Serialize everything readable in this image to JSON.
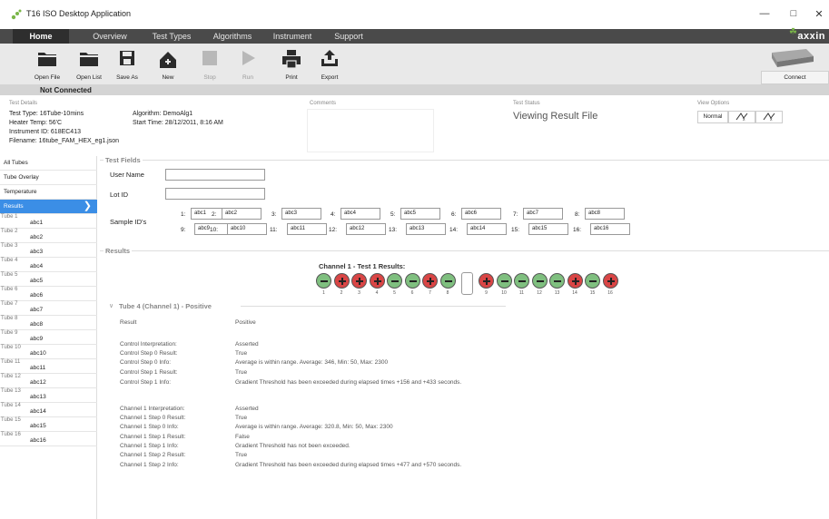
{
  "window": {
    "title": "T16 ISO Desktop Application",
    "minimize": "—",
    "maximize": "□",
    "close": "✕"
  },
  "menu": {
    "items": [
      "Home",
      "Overview",
      "Test Types",
      "Algorithms",
      "Instrument",
      "Support"
    ],
    "active": "Home",
    "brand": "axxin"
  },
  "toolbar": {
    "open_file": "Open File",
    "open_list": "Open List",
    "save_as": "Save As",
    "new": "New",
    "stop": "Stop",
    "run": "Run",
    "print": "Print",
    "export": "Export",
    "connect": "Connect"
  },
  "status": {
    "connection": "Not Connected"
  },
  "details": {
    "header": "Test Details",
    "test_type": "Test Type: 16Tube-10mins",
    "heater_temp": "Heater Temp: 56'C",
    "instrument_id": "Instrument ID: 618EC413",
    "filename": "Filename: 16tube_FAM_HEX_eg1.json",
    "algorithm": "Algorithm: DemoAlg1",
    "start_time": "Start Time: 28/12/2011, 8:16 AM",
    "comments_header": "Comments",
    "status_header": "Test Status",
    "status_value": "Viewing Result File",
    "view_header": "View Options",
    "view_normal": "Normal"
  },
  "sidebar": {
    "items": [
      "All Tubes",
      "Tube Overlay",
      "Temperature",
      "Results"
    ],
    "active": "Results",
    "tubes": [
      {
        "num": "Tube 1",
        "name": "abc1"
      },
      {
        "num": "Tube 2",
        "name": "abc2"
      },
      {
        "num": "Tube 3",
        "name": "abc3"
      },
      {
        "num": "Tube 4",
        "name": "abc4"
      },
      {
        "num": "Tube 5",
        "name": "abc5"
      },
      {
        "num": "Tube 6",
        "name": "abc6"
      },
      {
        "num": "Tube 7",
        "name": "abc7"
      },
      {
        "num": "Tube 8",
        "name": "abc8"
      },
      {
        "num": "Tube 9",
        "name": "abc9"
      },
      {
        "num": "Tube 10",
        "name": "abc10"
      },
      {
        "num": "Tube 11",
        "name": "abc11"
      },
      {
        "num": "Tube 12",
        "name": "abc12"
      },
      {
        "num": "Tube 13",
        "name": "abc13"
      },
      {
        "num": "Tube 14",
        "name": "abc14"
      },
      {
        "num": "Tube 15",
        "name": "abc15"
      },
      {
        "num": "Tube 16",
        "name": "abc16"
      }
    ]
  },
  "test_fields": {
    "legend": "Test Fields",
    "user_name_label": "User Name",
    "user_name": "",
    "lot_id_label": "Lot ID",
    "lot_id": "",
    "sample_ids_label": "Sample ID's",
    "samples": [
      {
        "n": "1:",
        "v": "abc1"
      },
      {
        "n": "2:",
        "v": "abc2"
      },
      {
        "n": "3:",
        "v": "abc3"
      },
      {
        "n": "4:",
        "v": "abc4"
      },
      {
        "n": "5:",
        "v": "abc5"
      },
      {
        "n": "6:",
        "v": "abc6"
      },
      {
        "n": "7:",
        "v": "abc7"
      },
      {
        "n": "8:",
        "v": "abc8"
      },
      {
        "n": "9:",
        "v": "abc9"
      },
      {
        "n": "10:",
        "v": "abc10"
      },
      {
        "n": "11:",
        "v": "abc11"
      },
      {
        "n": "12:",
        "v": "abc12"
      },
      {
        "n": "13:",
        "v": "abc13"
      },
      {
        "n": "14:",
        "v": "abc14"
      },
      {
        "n": "15:",
        "v": "abc15"
      },
      {
        "n": "16:",
        "v": "abc16"
      }
    ]
  },
  "results": {
    "legend": "Results",
    "channel_title": "Channel 1 - Test 1 Results:",
    "tube_states": [
      "neg",
      "pos",
      "pos",
      "pos",
      "neg",
      "neg",
      "pos",
      "neg",
      "pos",
      "neg",
      "neg",
      "neg",
      "neg",
      "pos",
      "neg",
      "pos"
    ],
    "tube_labels": [
      "1",
      "2",
      "3",
      "4",
      "5",
      "6",
      "7",
      "8",
      "9",
      "10",
      "11",
      "12",
      "13",
      "14",
      "15",
      "16"
    ],
    "tube_header": "Tube 4 (Channel 1) - Positive",
    "rows": [
      {
        "k": "Result",
        "v": "Positive"
      },
      {
        "k": "Control Interpretation:",
        "v": "Asserted"
      },
      {
        "k": "Control Step 0 Result:",
        "v": "True"
      },
      {
        "k": "Control Step 0 Info:",
        "v": "Average is within range. Average: 346, Min: 50, Max: 2300"
      },
      {
        "k": "Control Step 1 Result:",
        "v": "True"
      },
      {
        "k": "Control Step 1 Info:",
        "v": "Gradient Threshold has been exceeded during elapsed times +156 and +433 seconds."
      },
      {
        "k": "Channel 1 Interpretation:",
        "v": "Asserted"
      },
      {
        "k": "Channel 1 Step 0 Result:",
        "v": "True"
      },
      {
        "k": "Channel 1 Step 0 Info:",
        "v": "Average is within range. Average: 320.8, Min: 50, Max: 2300"
      },
      {
        "k": "Channel 1 Step 1 Result:",
        "v": "False"
      },
      {
        "k": "Channel 1 Step 1 Info:",
        "v": "Gradient Threshold has not been exceeded."
      },
      {
        "k": "Channel 1 Step 2 Result:",
        "v": "True"
      },
      {
        "k": "Channel 1 Step 2 Info:",
        "v": "Gradient Threshold has been exceeded during elapsed times +477 and +570 seconds."
      }
    ]
  },
  "colors": {
    "accent": "#3b8ee6",
    "positive": "#d94545",
    "negative": "#7fbf7f",
    "menubar": "#4a4a4a"
  }
}
